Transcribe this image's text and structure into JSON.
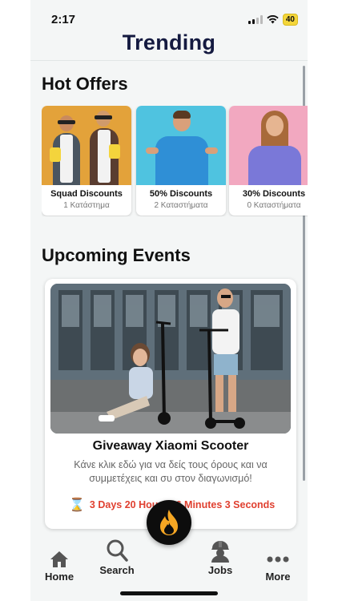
{
  "status_bar": {
    "time": "2:17",
    "battery": "40"
  },
  "header": {
    "title": "Trending"
  },
  "hot_offers": {
    "title": "Hot Offers",
    "items": [
      {
        "name": "Squad Discounts",
        "stores": "1 Κατάστημα"
      },
      {
        "name": "50% Discounts",
        "stores": "2 Καταστήματα"
      },
      {
        "name": "30% Discounts",
        "stores": "0 Καταστήματα"
      }
    ]
  },
  "upcoming_events": {
    "title": "Upcoming Events",
    "event": {
      "title": "Giveaway Xiaomi Scooter",
      "description": "Κάνε κλικ εδώ για να δείς τους όρους και να συμμετέχεις και συ στον διαγωνισμό!",
      "countdown": "3 Days 20 Hours 16 Minutes 3 Seconds"
    }
  },
  "tab_bar": {
    "home": "Home",
    "search": "Search",
    "jobs": "Jobs",
    "more": "More"
  },
  "colors": {
    "title": "#141a40",
    "countdown": "#e04030",
    "center_button": "#0d0d0d",
    "flame": "#f5a623"
  }
}
